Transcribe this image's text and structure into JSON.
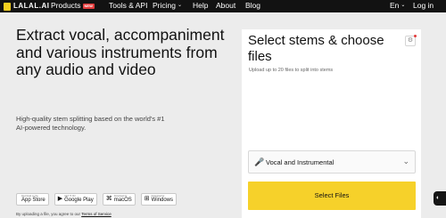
{
  "nav": {
    "logo_text": "LALAL.AI",
    "items": [
      {
        "label": "Products",
        "caret": "⌄",
        "badge": "NEW"
      },
      {
        "label": "Tools & API"
      },
      {
        "label": "Pricing",
        "caret": "⌄"
      },
      {
        "label": "Help"
      },
      {
        "label": "About"
      },
      {
        "label": "Blog"
      }
    ],
    "language": {
      "label": "En",
      "caret": "⌄"
    },
    "login": "Log in"
  },
  "hero": {
    "title": "Extract vocal, accompaniment and various instruments from any audio and video",
    "subtitle": "High-quality stem splitting based on the world's #1 AI-powered technology."
  },
  "stores": [
    {
      "small": "Download on the",
      "big": "App Store",
      "icon": "apple-icon"
    },
    {
      "small": "GET IT ON",
      "big": "Google Play",
      "icon": "google-play-icon"
    },
    {
      "small": "Download for",
      "big": "macOS",
      "icon": "macos-icon"
    },
    {
      "small": "Download for",
      "big": "Windows",
      "icon": "windows-icon"
    }
  ],
  "disclaimer": {
    "text": "By uploading a file, you agree to our ",
    "link": "Terms of Service"
  },
  "panel": {
    "title": "Select stems & choose files",
    "subtitle": "Upload up to 20 files to split into stems",
    "model": {
      "label": "Vocal and Instrumental",
      "icon": "microphone-icon"
    },
    "button": "Select Files"
  },
  "colors": {
    "accent": "#f6d12a",
    "nav_bg": "#121212",
    "badge": "#e23b3b"
  }
}
